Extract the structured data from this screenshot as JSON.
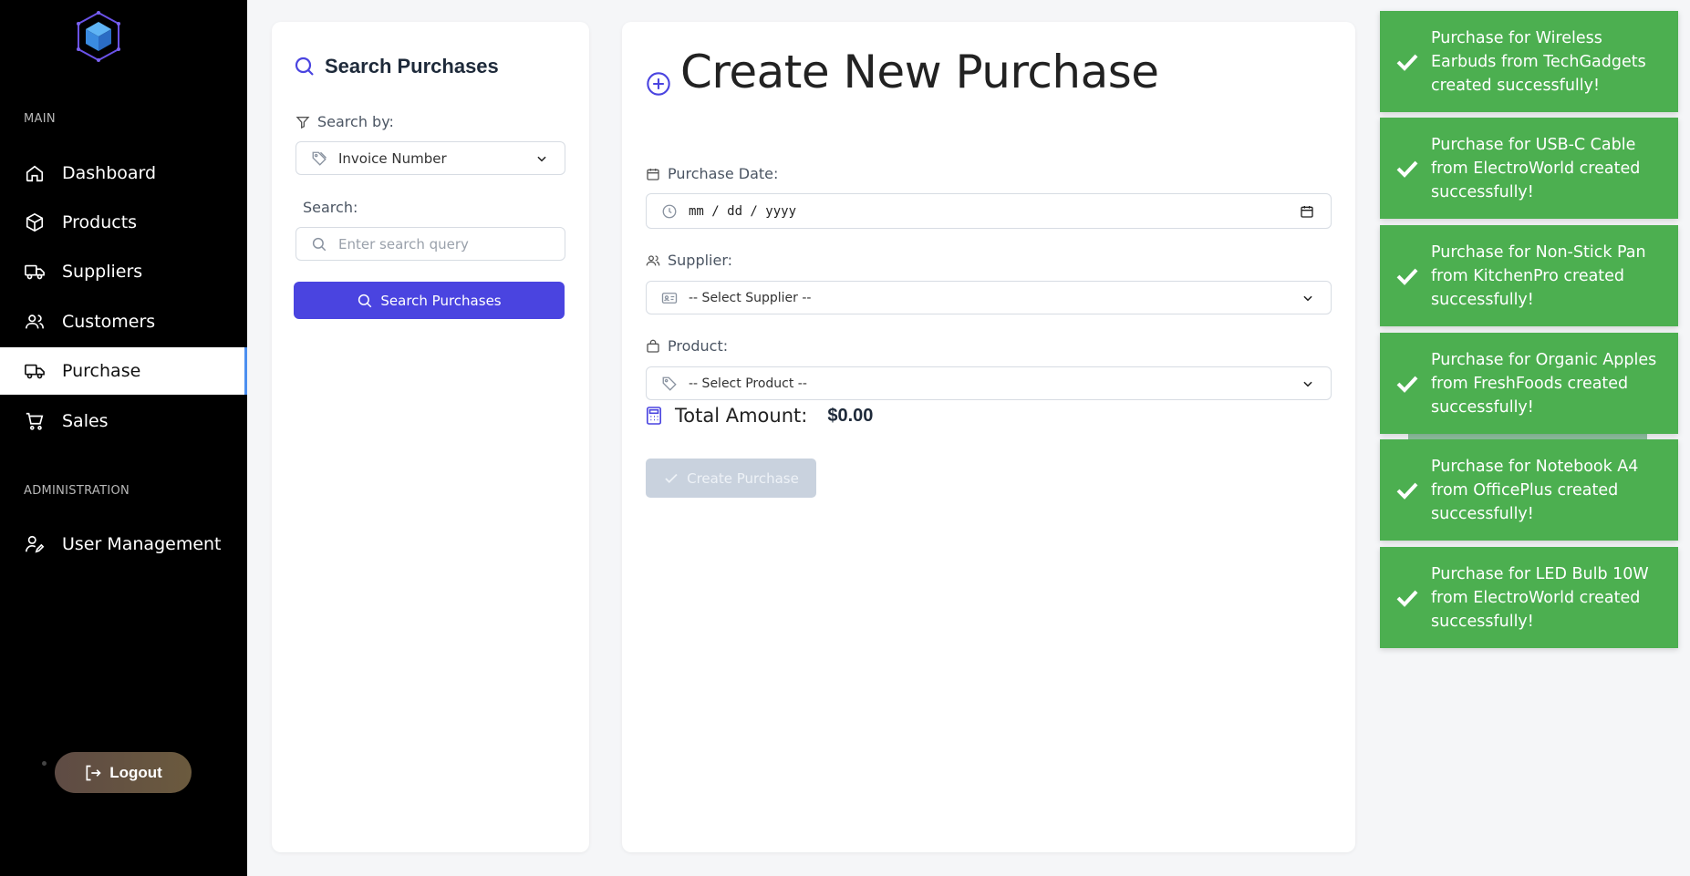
{
  "sidebar": {
    "main_label": "MAIN",
    "admin_label": "ADMINISTRATION",
    "items": [
      {
        "label": "Dashboard",
        "icon": "home-icon"
      },
      {
        "label": "Products",
        "icon": "box-icon"
      },
      {
        "label": "Suppliers",
        "icon": "truck-icon"
      },
      {
        "label": "Customers",
        "icon": "users-icon"
      },
      {
        "label": "Purchase",
        "icon": "truck-icon",
        "active": true
      },
      {
        "label": "Sales",
        "icon": "cart-icon"
      }
    ],
    "admin_items": [
      {
        "label": "User Management",
        "icon": "user-edit-icon"
      }
    ],
    "logout_label": "Logout"
  },
  "search": {
    "title": "Search Purchases",
    "search_by_label": "Search by:",
    "search_by_value": "Invoice Number",
    "search_label": "Search:",
    "placeholder": "Enter search query",
    "button_label": "Search Purchases"
  },
  "create": {
    "title": "Create New Purchase",
    "date_label": "Purchase Date:",
    "date_placeholder": "mm / dd / yyyy",
    "supplier_label": "Supplier:",
    "supplier_value": "-- Select Supplier --",
    "product_label": "Product:",
    "product_value": "-- Select Product --",
    "total_label": "Total Amount:",
    "total_value": "$0.00",
    "button_label": "Create Purchase"
  },
  "toasts": [
    "Purchase for Wireless Earbuds from TechGadgets created successfully!",
    "Purchase for USB-C Cable from ElectroWorld created successfully!",
    "Purchase for Non-Stick Pan from KitchenPro created successfully!",
    "Purchase for Organic Apples from FreshFoods created successfully!",
    "Purchase for Notebook A4 from OfficePlus created successfully!",
    "Purchase for LED Bulb 10W from ElectroWorld created successfully!"
  ],
  "colors": {
    "accent": "#4a44e0",
    "toast": "#4caf50",
    "sidebar": "#000000"
  }
}
